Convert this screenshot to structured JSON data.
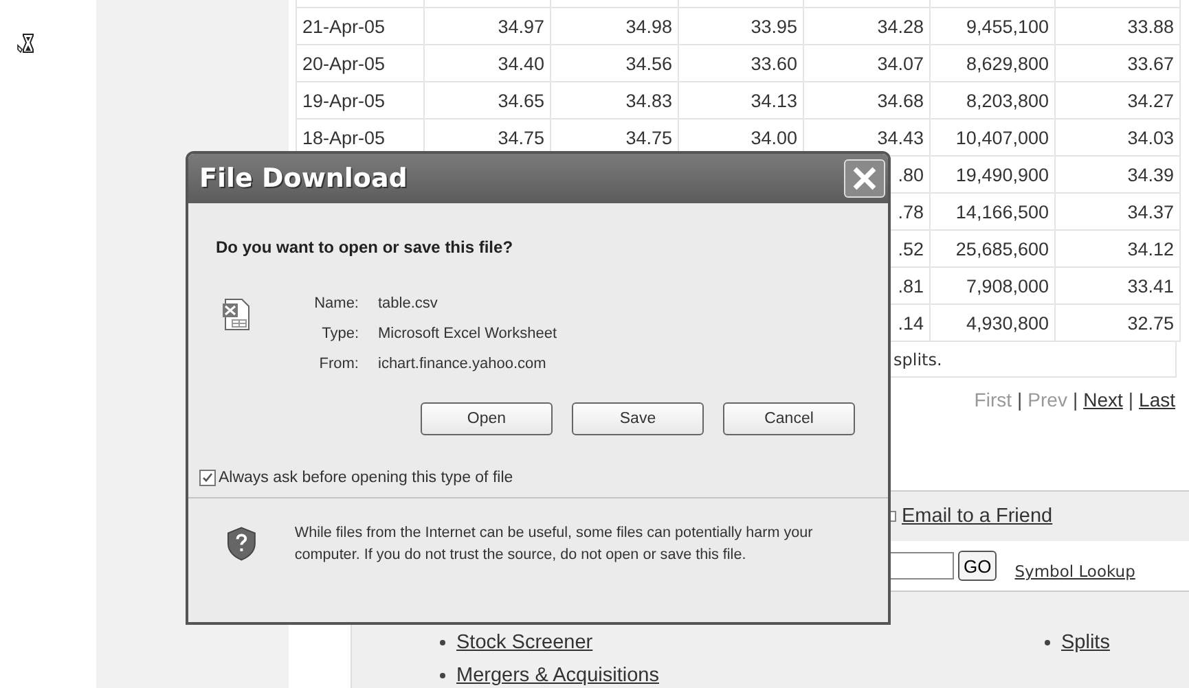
{
  "table": {
    "rows": [
      {
        "column_1": "21-Apr-05",
        "column_2": "34.97",
        "column_3": "34.98",
        "column_4": "33.95",
        "column_5": "34.28",
        "column_6": "9,455,100",
        "column_7": "33.88"
      },
      {
        "column_1": "20-Apr-05",
        "column_2": "34.40",
        "column_3": "34.56",
        "column_4": "33.60",
        "column_5": "34.07",
        "column_6": "8,629,800",
        "column_7": "33.67"
      },
      {
        "column_1": "19-Apr-05",
        "column_2": "34.65",
        "column_3": "34.83",
        "column_4": "34.13",
        "column_5": "34.68",
        "column_6": "8,203,800",
        "column_7": "34.27"
      },
      {
        "column_1": "18-Apr-05",
        "column_2": "34.75",
        "column_3": "34.75",
        "column_4": "34.00",
        "column_5": "34.43",
        "column_6": "10,407,000",
        "column_7": "34.03"
      },
      {
        "column_5": ".80",
        "column_6": "19,490,900",
        "column_7": "34.39"
      },
      {
        "column_5": ".78",
        "column_6": "14,166,500",
        "column_7": "34.37"
      },
      {
        "column_5": ".52",
        "column_6": "25,685,600",
        "column_7": "34.12"
      },
      {
        "column_5": ".81",
        "column_6": "7,908,000",
        "column_7": "33.41"
      },
      {
        "column_5": ".14",
        "column_6": "4,930,800",
        "column_7": "32.75"
      }
    ],
    "note": "splits."
  },
  "pagination": {
    "separator": "|",
    "links": [
      {
        "label": "First",
        "disabled": true
      },
      {
        "label": "Prev",
        "disabled": true
      },
      {
        "label": "Next",
        "disabled": false
      },
      {
        "label": "Last",
        "disabled": false
      }
    ]
  },
  "footer": {
    "email_link": "Email to a Friend",
    "go_button": "GO",
    "symbol_lookup": "Symbol Lookup",
    "links": [
      "Stock Screener",
      "Splits",
      "Mergers & Acquisitions"
    ]
  },
  "dialog": {
    "title": "File Download",
    "question": "Do you want to open or save this file?",
    "fields": [
      {
        "label": "Name:",
        "value": "table.csv"
      },
      {
        "label": "Type:",
        "value": "Microsoft Excel Worksheet"
      },
      {
        "label": "From:",
        "value": "ichart.finance.yahoo.com"
      }
    ],
    "buttons": [
      "Open",
      "Save",
      "Cancel"
    ],
    "checkbox": {
      "label": "Always ask before opening this type of file",
      "checked": true
    },
    "warning": "While files from the Internet can be useful, some files can potentially harm your computer. If you do not trust the source, do not open or save this file."
  }
}
